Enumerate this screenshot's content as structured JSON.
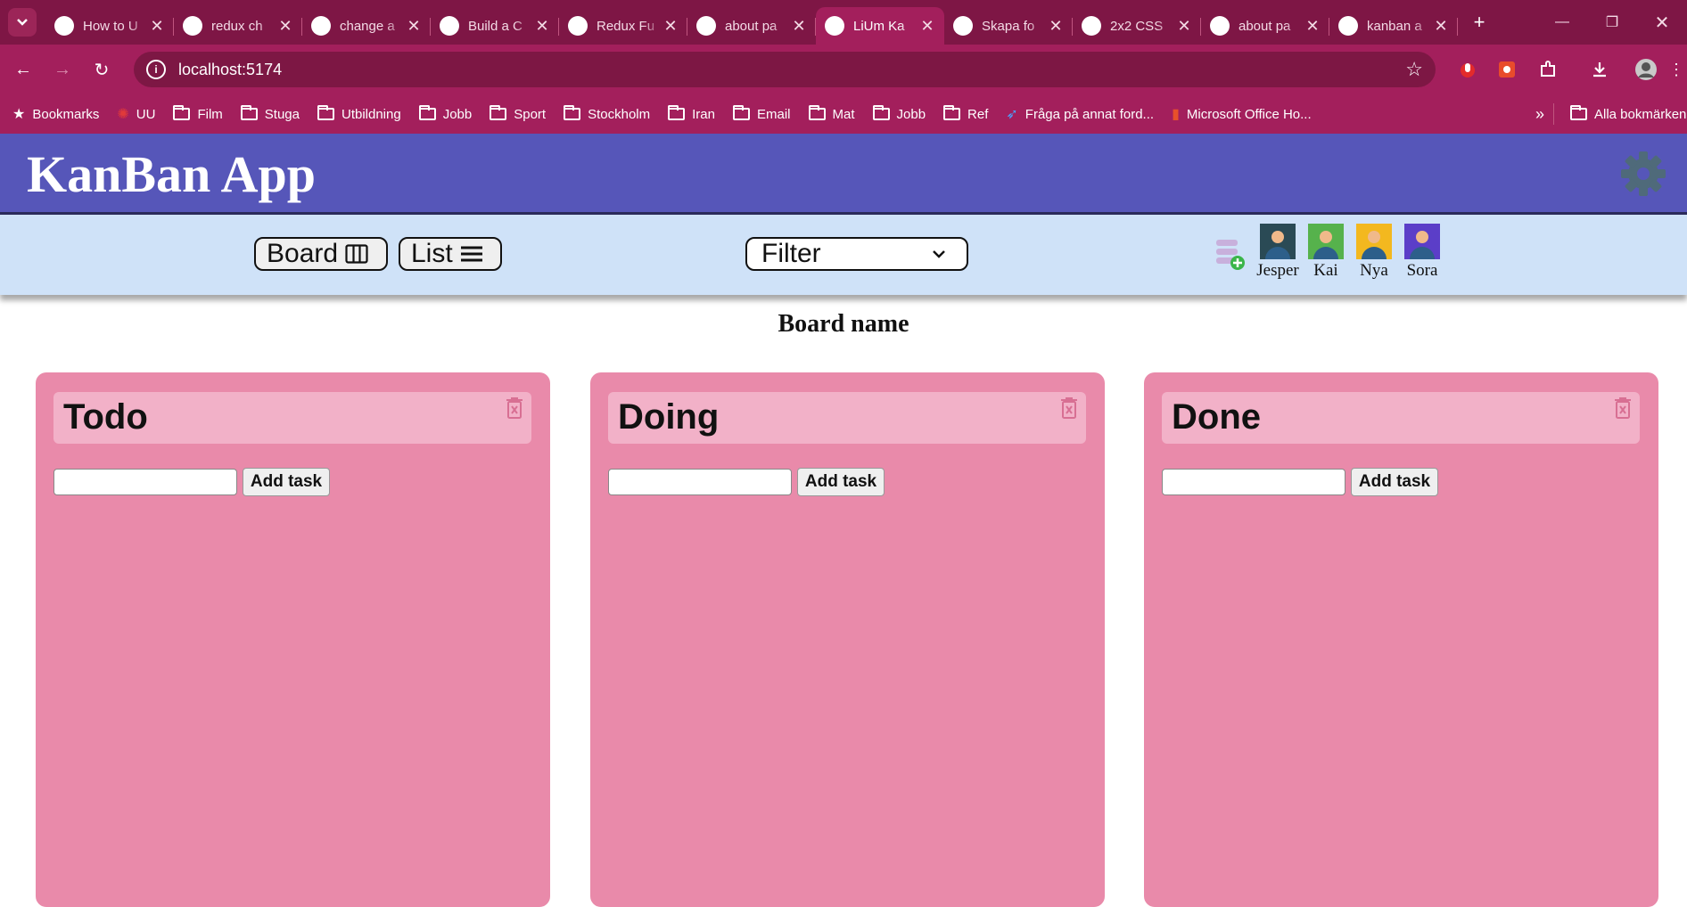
{
  "browser": {
    "tabs": [
      {
        "title": "How to U",
        "fav": "angular-icon"
      },
      {
        "title": "redux ch",
        "fav": "google-icon"
      },
      {
        "title": "change a",
        "fav": "google-icon"
      },
      {
        "title": "Build a C",
        "fav": "youtube-icon"
      },
      {
        "title": "Redux Fu",
        "fav": "redux-icon"
      },
      {
        "title": "about pa",
        "fav": "google-icon"
      },
      {
        "title": "LiUm Ka",
        "fav": "app-icon"
      },
      {
        "title": "Skapa fo",
        "fav": "skapa-icon"
      },
      {
        "title": "2x2 CSS",
        "fav": "codepen-icon"
      },
      {
        "title": "about pa",
        "fav": "github-icon"
      },
      {
        "title": "kanban a",
        "fav": "google-icon"
      }
    ],
    "url": "localhost:5174",
    "bookmarks": [
      {
        "label": "Bookmarks",
        "icon": "star-icon"
      },
      {
        "label": "UU",
        "icon": "uu-icon"
      },
      {
        "label": "Film",
        "icon": "folder-icon"
      },
      {
        "label": "Stuga",
        "icon": "folder-icon"
      },
      {
        "label": "Utbildning",
        "icon": "folder-icon"
      },
      {
        "label": "Jobb",
        "icon": "folder-icon"
      },
      {
        "label": "Sport",
        "icon": "folder-icon"
      },
      {
        "label": "Stockholm",
        "icon": "folder-icon"
      },
      {
        "label": "Iran",
        "icon": "folder-icon"
      },
      {
        "label": "Email",
        "icon": "folder-icon"
      },
      {
        "label": "Mat",
        "icon": "folder-icon"
      },
      {
        "label": "Jobb",
        "icon": "folder-icon"
      },
      {
        "label": "Ref",
        "icon": "folder-icon"
      },
      {
        "label": "Fråga på annat ford...",
        "icon": "link-icon"
      },
      {
        "label": "Microsoft Office Ho...",
        "icon": "office-icon"
      }
    ],
    "all_bookmarks": "Alla bokmärken"
  },
  "app": {
    "title": "KanBan App",
    "view_buttons": {
      "board": "Board",
      "list": "List"
    },
    "filter": {
      "selected": "Filter"
    },
    "users": [
      {
        "name": "Jesper",
        "color": "#2a4a55"
      },
      {
        "name": "Kai",
        "color": "#56b24c"
      },
      {
        "name": "Nya",
        "color": "#f3b81f"
      },
      {
        "name": "Sora",
        "color": "#5b3ec8"
      }
    ],
    "board_name": "Board name",
    "columns": [
      {
        "title": "Todo",
        "add_label": "Add task"
      },
      {
        "title": "Doing",
        "add_label": "Add task"
      },
      {
        "title": "Done",
        "add_label": "Add task"
      }
    ]
  },
  "colors": {
    "tab_bar": "#7e1645",
    "toolbar": "#a31f5c",
    "header": "#5656b9",
    "controls": "#cfe2f8",
    "column": "#e98aaa",
    "column_head": "#f2b1c8"
  }
}
